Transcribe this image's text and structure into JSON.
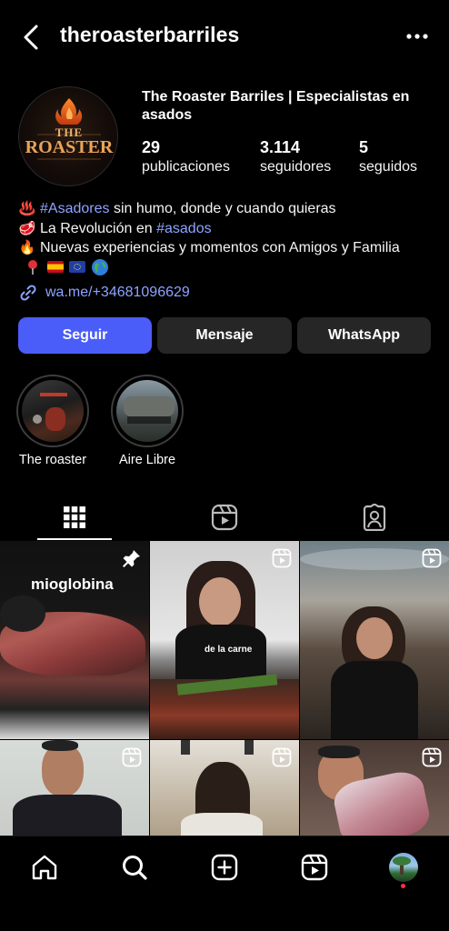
{
  "header": {
    "username": "theroasterbarriles"
  },
  "profile": {
    "display_name": "The Roaster Barriles | Especialistas en asados",
    "logo_text_top": "THE",
    "logo_text_main": "ROASTER",
    "stats": [
      {
        "value": "29",
        "label": "publicaciones"
      },
      {
        "value": "3.114",
        "label": "seguidores"
      },
      {
        "value": "5",
        "label": "seguidos"
      }
    ],
    "bio": {
      "line1_emoji": "♨️",
      "line1_tag": "#Asadores",
      "line1_text": " sin humo, donde y cuando quieras",
      "line2_emoji": "🥩",
      "line2_text": "La Revolución en ",
      "line2_tag": "#asados",
      "line3_emoji": "🔥",
      "line3_text": "Nuevas experiencias y momentos con Amigos y Familia",
      "line4_emojis": [
        "pin-icon",
        "spain-flag",
        "eu-flag",
        "globe-icon"
      ]
    },
    "link": "wa.me/+34681096629"
  },
  "actions": {
    "follow": "Seguir",
    "message": "Mensaje",
    "whatsapp": "WhatsApp"
  },
  "highlights": [
    {
      "label": "The roaster"
    },
    {
      "label": "Aire Libre"
    }
  ],
  "tabs": [
    "grid",
    "reels",
    "tagged"
  ],
  "posts": [
    {
      "overlay": "mioglobina",
      "badge": "pinned"
    },
    {
      "overlay": "de la carne",
      "badge": "reel"
    },
    {
      "overlay": "",
      "badge": "reel"
    },
    {
      "overlay": "",
      "badge": "reel"
    },
    {
      "overlay": "",
      "badge": "reel"
    },
    {
      "overlay": "",
      "badge": "reel"
    }
  ],
  "colors": {
    "accent": "#4a5df9",
    "link": "#8ea3ff",
    "button_dark": "#262626",
    "background": "#000000"
  }
}
